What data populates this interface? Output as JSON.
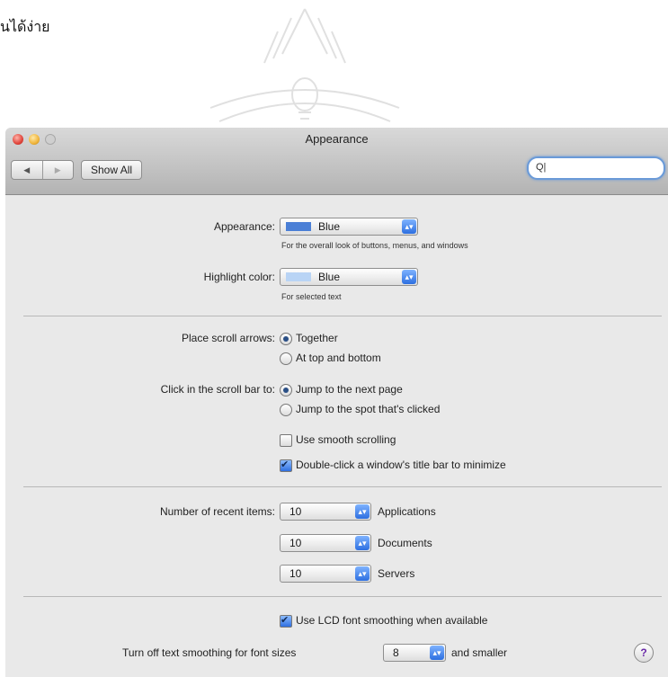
{
  "document": {
    "thai_fragment": "นได้ง่าย"
  },
  "window": {
    "title": "Appearance",
    "show_all_label": "Show All",
    "nav_back_icon": "◀",
    "nav_forward_icon": "▶",
    "search": {
      "icon_glyph": "Q|",
      "value": ""
    }
  },
  "appearance": {
    "label": "Appearance:",
    "value": "Blue",
    "swatch_color": "#4a7fd6",
    "help": "For the overall look of buttons, menus, and windows"
  },
  "highlight": {
    "label": "Highlight color:",
    "value": "Blue",
    "swatch_color": "#b9d4f5",
    "help": "For selected text"
  },
  "scroll_arrows": {
    "label": "Place scroll arrows:",
    "options": [
      "Together",
      "At top and bottom"
    ],
    "selected": "Together"
  },
  "scroll_click": {
    "label": "Click in the scroll bar to:",
    "options": [
      "Jump to the next page",
      "Jump to the spot that's clicked"
    ],
    "selected": "Jump to the next page"
  },
  "checkboxes": {
    "smooth_scrolling": {
      "label": "Use smooth scrolling",
      "checked": false
    },
    "double_click_minimize": {
      "label": "Double-click a window's title bar to minimize",
      "checked": true
    },
    "lcd_smoothing": {
      "label": "Use LCD font smoothing when available",
      "checked": true
    }
  },
  "recent_items": {
    "label": "Number of recent items:",
    "rows": [
      {
        "value": "10",
        "label": "Applications"
      },
      {
        "value": "10",
        "label": "Documents"
      },
      {
        "value": "10",
        "label": "Servers"
      }
    ]
  },
  "font_smoothing": {
    "prefix": "Turn off text smoothing for font sizes",
    "value": "8",
    "suffix": "and smaller"
  },
  "help_button": "?",
  "colors": {
    "accent": "#2d6fe0",
    "help_glyph": "#6a2aa8"
  }
}
